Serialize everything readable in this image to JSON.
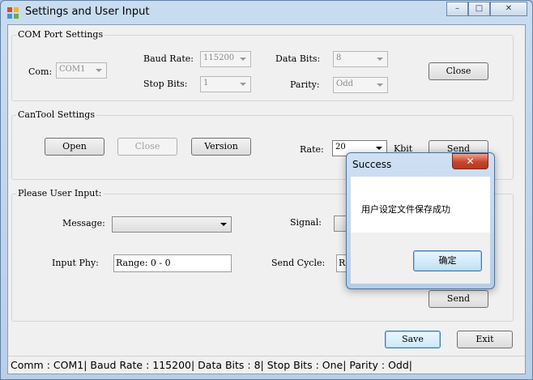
{
  "window": {
    "title": "Settings and User Input",
    "minimize": "–",
    "maximize": "□",
    "close": "✕"
  },
  "com_port": {
    "group_title": "COM Port Settings",
    "com_label": "Com:",
    "com_value": "COM1",
    "baud_label": "Baud Rate:",
    "baud_value": "115200",
    "stop_label": "Stop Bits:",
    "stop_value": "1",
    "data_label": "Data Bits:",
    "data_value": "8",
    "parity_label": "Parity:",
    "parity_value": "Odd",
    "close_button": "Close"
  },
  "cantool": {
    "group_title": "CanTool Settings",
    "open_button": "Open",
    "close_button": "Close",
    "version_button": "Version",
    "rate_label": "Rate:",
    "rate_value": "20",
    "rate_unit": "Kbit",
    "send_button": "Send"
  },
  "user_input": {
    "group_title": "Please User Input:",
    "message_label": "Message:",
    "message_value": "",
    "signal_label": "Signal:",
    "phy_label": "Input Phy:",
    "phy_value": "Range: 0 - 0",
    "cycle_label": "Send Cycle:",
    "cycle_value_partial": "Ra",
    "send_button": "Send"
  },
  "footer": {
    "save_button": "Save",
    "exit_button": "Exit"
  },
  "status_bar": {
    "text": "Comm : COM1|  Baud Rate : 115200|  Data Bits : 8|  Stop Bits : One|  Parity : Odd|"
  },
  "dialog": {
    "title": "Success",
    "close": "✕",
    "message": "用户设定文件保存成功",
    "ok_button": "确定"
  }
}
